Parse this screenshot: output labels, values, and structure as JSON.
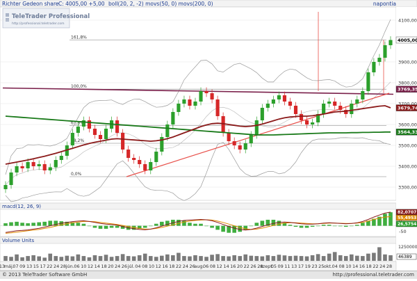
{
  "header": {
    "title": "Richter Gedeon share",
    "close_text": "C: 4005,00 +5,00",
    "indicators": "boll(20, 2, -2)  movs(50, 0)  movs(200, 0)",
    "period": "napontia"
  },
  "logo": {
    "name": "TeleTrader Professional",
    "url": "http://professional.teletrader.com"
  },
  "price_axis": {
    "ticks": [
      "4100,00",
      "3900,00",
      "3800,00",
      "3700,00",
      "3600,00",
      "3500,00",
      "3400,00",
      "3300,00"
    ],
    "badges": [
      {
        "label": "4005,00",
        "color": "#ffffff",
        "text_color": "#000000"
      },
      {
        "label": "3769,35",
        "color": "#7a1f4a",
        "text_color": "#ffffff"
      },
      {
        "label": "3679,74",
        "color": "#8b1a1a",
        "text_color": "#ffffff"
      },
      {
        "label": "3564,33",
        "color": "#1a7a1a",
        "text_color": "#ffffff"
      }
    ]
  },
  "fib_levels": [
    "161,8%",
    "100,0%",
    "61,8%",
    "38,2%",
    "0,0%"
  ],
  "macd": {
    "label": "macd(12, 26, 9)",
    "axis_labels": [
      "0",
      "-50"
    ],
    "badges": [
      {
        "label": "82,0707",
        "color": "#8b1a1a"
      },
      {
        "label": "55,4953",
        "color": "#e08a00"
      },
      {
        "label": "26,5754",
        "color": "#2ca02c"
      }
    ]
  },
  "volume": {
    "label": "Volume Units",
    "axis_labels": [
      "1250000",
      "46389"
    ]
  },
  "x_axis": {
    "labels": [
      "13",
      "máj.",
      "07",
      "09",
      "13",
      "15",
      "17",
      "22",
      "24",
      "28",
      "jún.",
      "06",
      "10",
      "12",
      "14",
      "18",
      "20",
      "24",
      "26",
      "júl.",
      "04",
      "08",
      "10",
      "12",
      "16",
      "18",
      "22",
      "24",
      "26",
      "aug.",
      "06",
      "08",
      "12",
      "14",
      "16",
      "20",
      "22",
      "26",
      "28",
      "szept.",
      "05",
      "09",
      "11",
      "13",
      "17",
      "19",
      "23",
      "25",
      "okt.",
      "04",
      "08",
      "10",
      "14",
      "16",
      "18",
      "22",
      "24",
      "28"
    ]
  },
  "footer": {
    "copyright": "© 2013 TeleTrader Software GmbH",
    "url": "http://professional.teletrader.com"
  },
  "colors": {
    "up_candle": "#2ca02c",
    "down_candle": "#d62728",
    "ma50": "#8b1a1a",
    "ma200": "#1a7a1a",
    "resistance": "#7a1f4a",
    "support": "#e8504a"
  },
  "chart_data": {
    "type": "candlestick",
    "title": "Richter Gedeon share",
    "ylim": [
      3250,
      4150
    ],
    "y_ticks": [
      3300,
      3400,
      3500,
      3600,
      3700,
      3800,
      3900,
      4100
    ],
    "last_close": 4005,
    "change": 5,
    "indicators": {
      "bollinger_last": 3769.35,
      "ma50_last": 3679.74,
      "ma200_last": 3564.33
    },
    "fibonacci": [
      {
        "label": "161,8%",
        "value": 4005
      },
      {
        "label": "100,0%",
        "value": 3769.35
      },
      {
        "label": "61,8%",
        "value": 3595
      },
      {
        "label": "38,2%",
        "value": 3510
      },
      {
        "label": "0,0%",
        "value": 3350
      }
    ],
    "price_series": [
      3310,
      3370,
      3400,
      3390,
      3420,
      3400,
      3410,
      3380,
      3395,
      3430,
      3450,
      3500,
      3560,
      3590,
      3620,
      3580,
      3550,
      3530,
      3580,
      3620,
      3560,
      3480,
      3440,
      3430,
      3410,
      3380,
      3420,
      3470,
      3540,
      3600,
      3660,
      3700,
      3720,
      3690,
      3710,
      3760,
      3750,
      3720,
      3640,
      3560,
      3520,
      3500,
      3480,
      3510,
      3550,
      3620,
      3680,
      3700,
      3720,
      3740,
      3710,
      3690,
      3650,
      3620,
      3600,
      3610,
      3650,
      3700,
      3710,
      3690,
      3670,
      3650,
      3700,
      3720,
      3760,
      3850,
      3900,
      3920,
      3980,
      4005
    ],
    "ma50": [
      3410,
      3415,
      3420,
      3425,
      3430,
      3436,
      3442,
      3448,
      3455,
      3462,
      3470,
      3478,
      3486,
      3494,
      3502,
      3509,
      3515,
      3520,
      3525,
      3530,
      3532,
      3530,
      3528,
      3526,
      3524,
      3522,
      3520,
      3522,
      3526,
      3532,
      3540,
      3550,
      3560,
      3570,
      3580,
      3590,
      3598,
      3604,
      3606,
      3604,
      3600,
      3596,
      3592,
      3590,
      3592,
      3596,
      3602,
      3610,
      3618,
      3626,
      3632,
      3636,
      3638,
      3640,
      3640,
      3642,
      3646,
      3650,
      3655,
      3660,
      3662,
      3664,
      3668,
      3672,
      3676,
      3680,
      3684,
      3688,
      3690,
      3680
    ],
    "ma200": [
      3640,
      3638,
      3636,
      3634,
      3632,
      3630,
      3628,
      3626,
      3624,
      3622,
      3620,
      3618,
      3616,
      3614,
      3612,
      3610,
      3608,
      3606,
      3604,
      3602,
      3600,
      3598,
      3596,
      3594,
      3592,
      3590,
      3588,
      3586,
      3584,
      3582,
      3580,
      3578,
      3576,
      3574,
      3572,
      3570,
      3568,
      3566,
      3564,
      3562,
      3560,
      3558,
      3556,
      3554,
      3552,
      3550,
      3550,
      3550,
      3550,
      3551,
      3552,
      3553,
      3554,
      3555,
      3556,
      3557,
      3558,
      3559,
      3560,
      3560,
      3560,
      3560,
      3561,
      3561,
      3562,
      3562,
      3563,
      3563,
      3564,
      3564
    ],
    "macd_line": [
      -40,
      -35,
      -30,
      -28,
      -25,
      -20,
      -15,
      -8,
      0,
      8,
      15,
      20,
      25,
      28,
      30,
      26,
      20,
      14,
      10,
      8,
      4,
      -4,
      -12,
      -18,
      -22,
      -24,
      -20,
      -12,
      -2,
      8,
      18,
      26,
      32,
      34,
      36,
      38,
      36,
      30,
      20,
      8,
      -4,
      -14,
      -22,
      -26,
      -22,
      -14,
      -4,
      6,
      14,
      20,
      22,
      20,
      16,
      12,
      10,
      10,
      12,
      16,
      18,
      16,
      14,
      12,
      14,
      18,
      26,
      38,
      52,
      64,
      76,
      82
    ],
    "signal_line": [
      -45,
      -42,
      -38,
      -34,
      -30,
      -26,
      -22,
      -16,
      -10,
      -2,
      6,
      12,
      18,
      22,
      26,
      26,
      24,
      20,
      16,
      12,
      8,
      2,
      -4,
      -10,
      -16,
      -20,
      -20,
      -16,
      -10,
      -2,
      6,
      14,
      22,
      28,
      32,
      34,
      36,
      34,
      28,
      20,
      10,
      0,
      -10,
      -18,
      -22,
      -20,
      -14,
      -6,
      2,
      10,
      16,
      18,
      18,
      16,
      14,
      12,
      12,
      14,
      16,
      16,
      15,
      14,
      14,
      16,
      20,
      28,
      38,
      46,
      52,
      55
    ],
    "volume_series": [
      0.3,
      0.25,
      0.4,
      0.22,
      0.3,
      0.35,
      0.28,
      0.2,
      0.45,
      0.3,
      0.25,
      0.32,
      0.28,
      0.4,
      0.3,
      0.22,
      0.35,
      0.3,
      0.38,
      0.25,
      0.3,
      0.42,
      0.3,
      0.28,
      0.35,
      0.45,
      0.3,
      0.25,
      0.32,
      0.4,
      0.35,
      0.5,
      0.3,
      0.28,
      0.35,
      0.3,
      0.25,
      0.38,
      0.42,
      0.3,
      0.28,
      0.35,
      0.3,
      0.4,
      0.32,
      0.3,
      0.28,
      0.35,
      0.3,
      0.38,
      0.34,
      0.3,
      0.32,
      0.3,
      0.28,
      0.35,
      0.42,
      0.3,
      0.45,
      0.55,
      0.35,
      0.3,
      0.4,
      0.32,
      0.3,
      0.45,
      0.5,
      0.85,
      0.4,
      0.35
    ]
  }
}
